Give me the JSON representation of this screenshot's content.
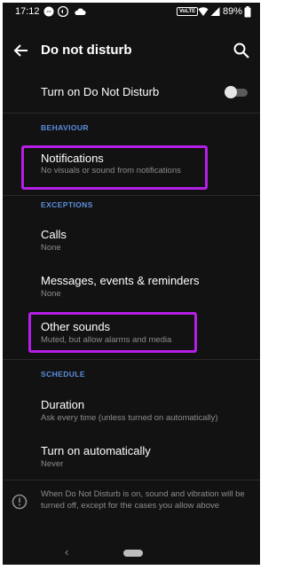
{
  "status_bar": {
    "time": "17:12",
    "network_label": "VoLTE",
    "battery_percent": "89%"
  },
  "app_bar": {
    "title": "Do not disturb"
  },
  "dnd_toggle": {
    "label": "Turn on Do Not Disturb",
    "enabled": false
  },
  "sections": {
    "behaviour": "BEHAVIOUR",
    "exceptions": "EXCEPTIONS",
    "schedule": "SCHEDULE"
  },
  "items": {
    "notifications": {
      "title": "Notifications",
      "subtitle": "No visuals or sound from notifications"
    },
    "calls": {
      "title": "Calls",
      "subtitle": "None"
    },
    "messages": {
      "title": "Messages, events & reminders",
      "subtitle": "None"
    },
    "other_sounds": {
      "title": "Other sounds",
      "subtitle": "Muted, but allow alarms and media"
    },
    "duration": {
      "title": "Duration",
      "subtitle": "Ask every time (unless turned on automatically)"
    },
    "turn_on_auto": {
      "title": "Turn on automatically",
      "subtitle": "Never"
    }
  },
  "footer_info": "When Do Not Disturb is on, sound and vibration will be turned off, except for the cases you allow above",
  "nav": {
    "back_glyph": "‹"
  },
  "colors": {
    "background": "#121212",
    "section_header": "#5b8fe0",
    "highlight_box": "#b41ee6",
    "subtitle": "#8c8c8c"
  }
}
